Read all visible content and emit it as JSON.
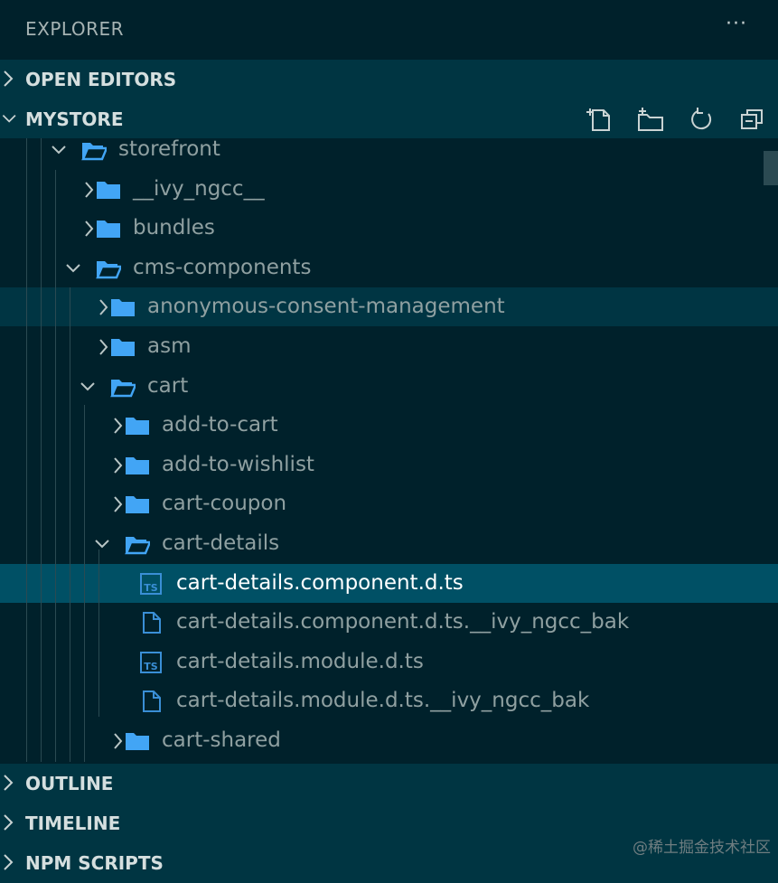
{
  "header": {
    "title": "EXPLORER",
    "more_label": "···"
  },
  "sections": {
    "open_editors": "OPEN EDITORS",
    "project": "MYSTORE",
    "outline": "OUTLINE",
    "timeline": "TIMELINE",
    "npm_scripts": "NPM SCRIPTS"
  },
  "actions": [
    "new-file-icon",
    "new-folder-icon",
    "refresh-icon",
    "collapse-all-icon"
  ],
  "tree": [
    {
      "label": "storefront",
      "depth": 0,
      "kind": "folder",
      "open": true
    },
    {
      "label": "__ivy_ngcc__",
      "depth": 1,
      "kind": "folder",
      "open": false
    },
    {
      "label": "bundles",
      "depth": 1,
      "kind": "folder",
      "open": false
    },
    {
      "label": "cms-components",
      "depth": 1,
      "kind": "folder",
      "open": true
    },
    {
      "label": "anonymous-consent-management",
      "depth": 2,
      "kind": "folder",
      "open": false,
      "state": "hover"
    },
    {
      "label": "asm",
      "depth": 2,
      "kind": "folder",
      "open": false
    },
    {
      "label": "cart",
      "depth": 2,
      "kind": "folder",
      "open": true
    },
    {
      "label": "add-to-cart",
      "depth": 3,
      "kind": "folder",
      "open": false
    },
    {
      "label": "add-to-wishlist",
      "depth": 3,
      "kind": "folder",
      "open": false
    },
    {
      "label": "cart-coupon",
      "depth": 3,
      "kind": "folder",
      "open": false
    },
    {
      "label": "cart-details",
      "depth": 3,
      "kind": "folder",
      "open": true
    },
    {
      "label": "cart-details.component.d.ts",
      "depth": 4,
      "kind": "ts",
      "state": "selected"
    },
    {
      "label": "cart-details.component.d.ts.__ivy_ngcc_bak",
      "depth": 4,
      "kind": "file"
    },
    {
      "label": "cart-details.module.d.ts",
      "depth": 4,
      "kind": "ts"
    },
    {
      "label": "cart-details.module.d.ts.__ivy_ngcc_bak",
      "depth": 4,
      "kind": "file"
    },
    {
      "label": "cart-shared",
      "depth": 3,
      "kind": "folder",
      "open": false
    }
  ],
  "ts_badge": "TS",
  "watermark": "@稀土掘金技术社区",
  "colors": {
    "folder": "#42a5f5",
    "ts": "#3a8fd6",
    "selected": "#005065",
    "hover": "#003543",
    "section": "#003542"
  }
}
